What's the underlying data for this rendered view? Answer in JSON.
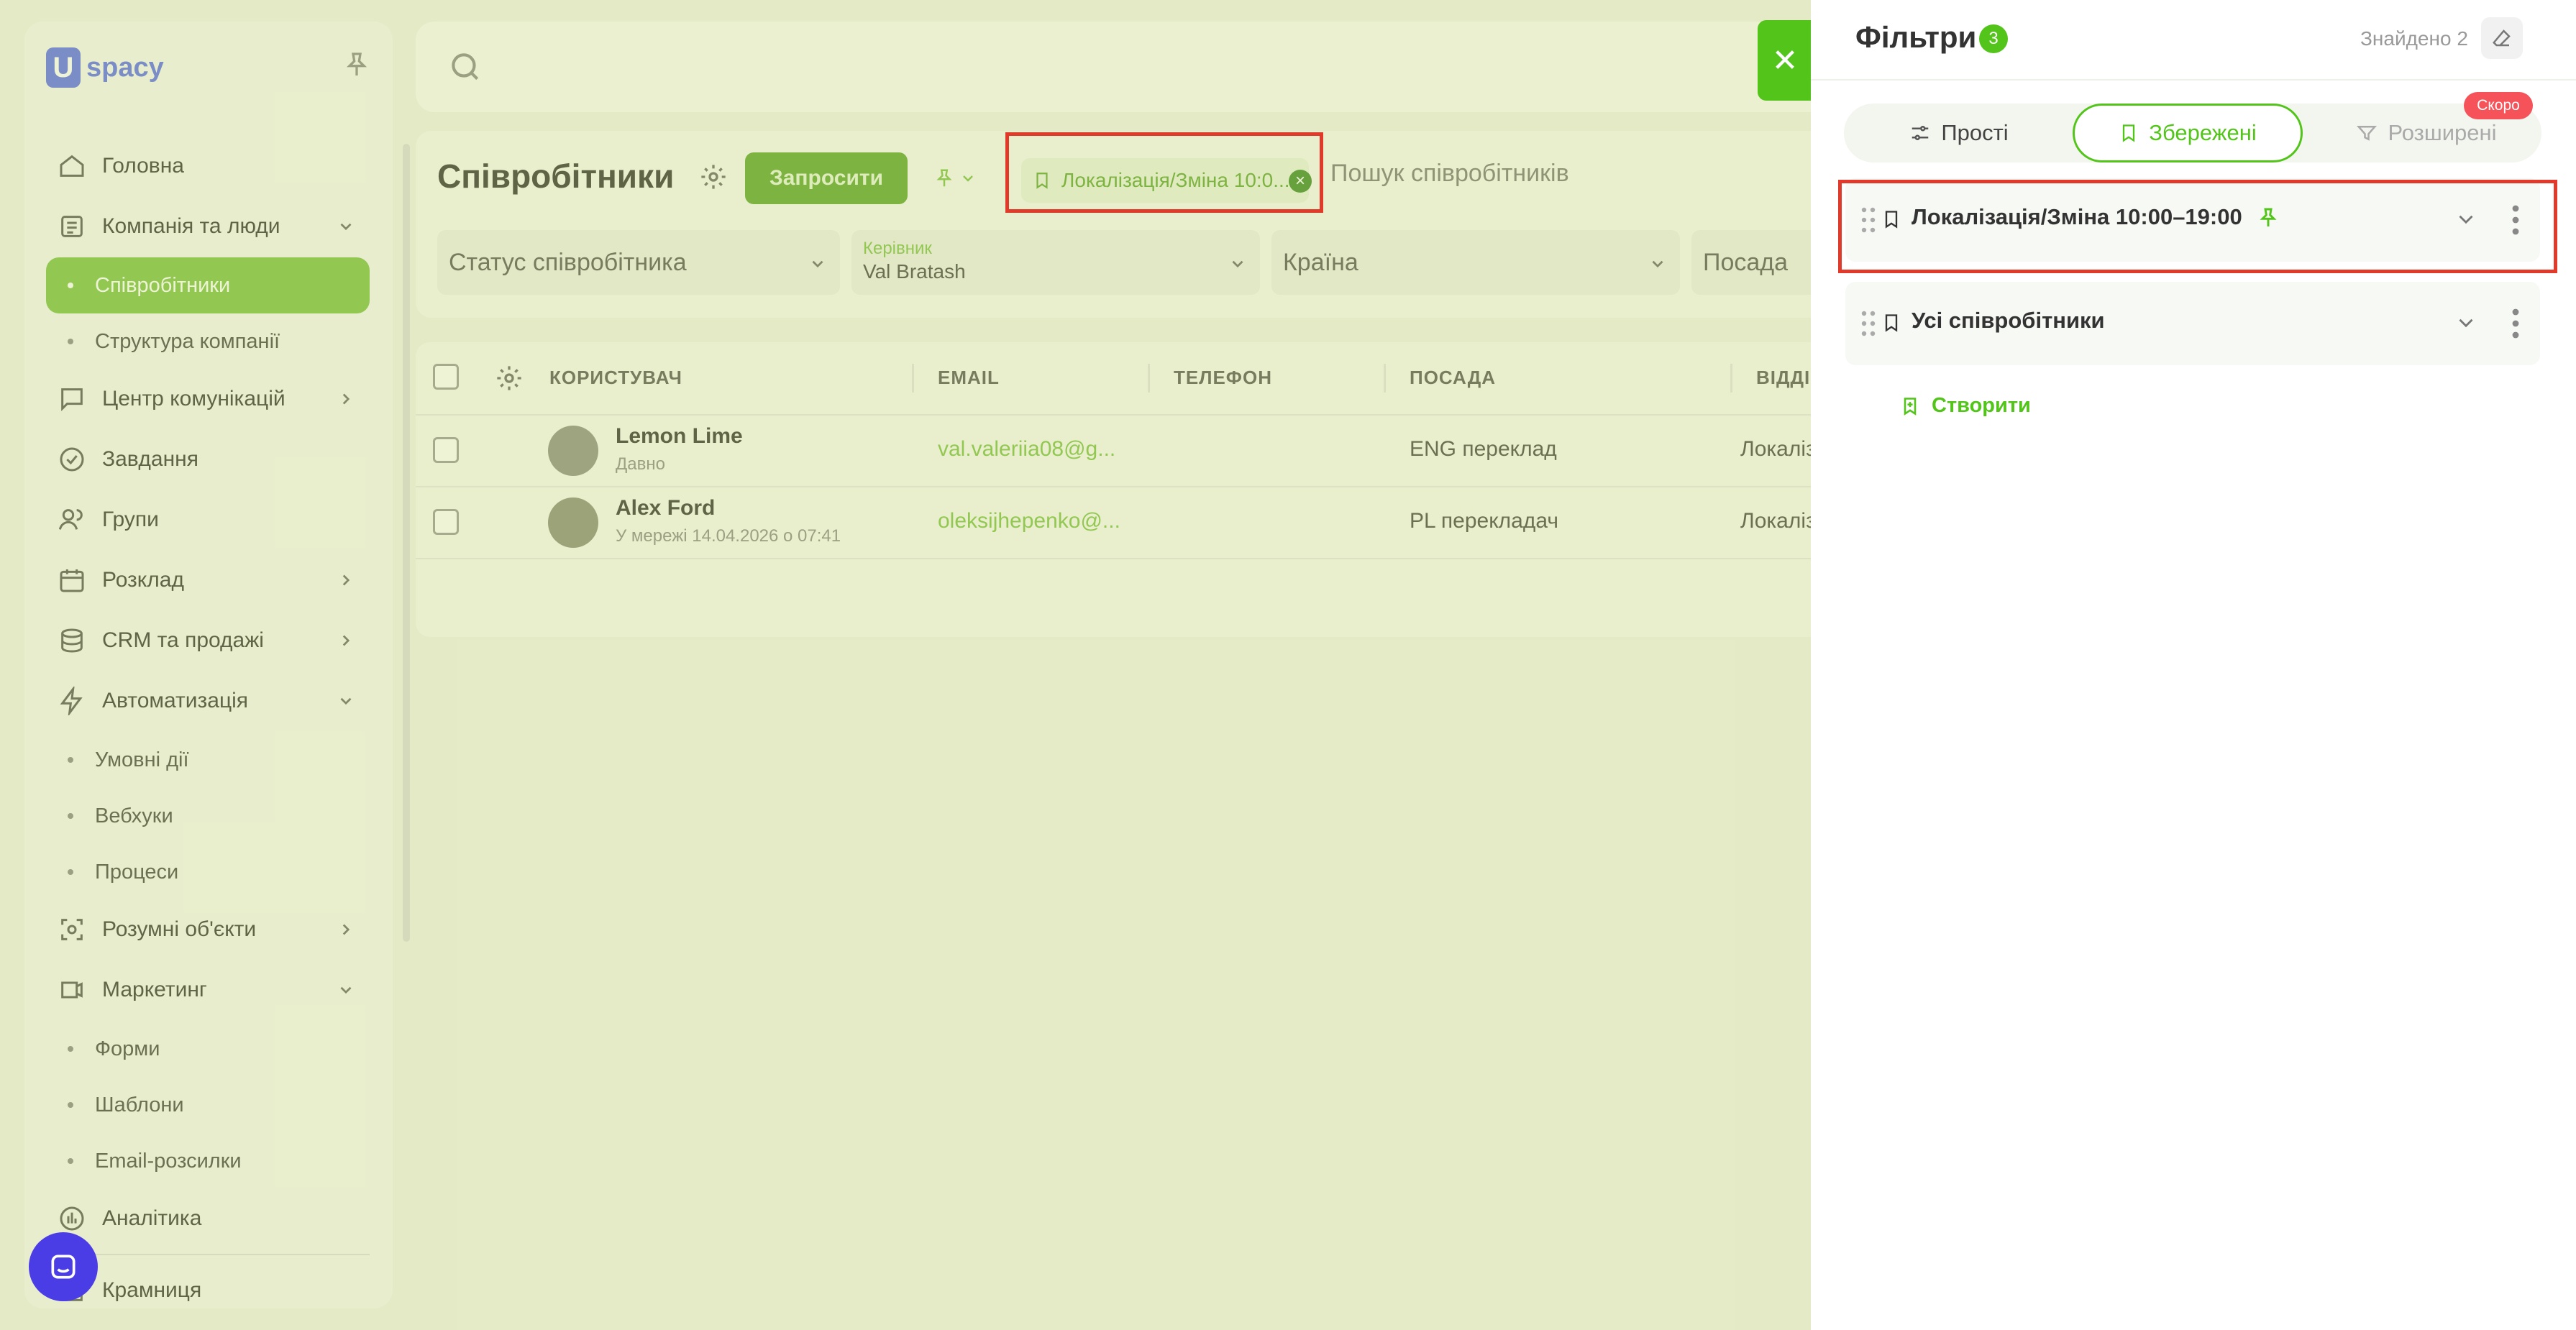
{
  "logo": {
    "mark": "U",
    "text": "spacy"
  },
  "sidebar": {
    "items": [
      {
        "label": "Головна",
        "icon": "home-icon",
        "type": "item"
      },
      {
        "label": "Компанія та люди",
        "icon": "company-icon",
        "type": "item",
        "chevron": "down"
      },
      {
        "label": "Співробітники",
        "type": "sub",
        "active": true
      },
      {
        "label": "Структура компанії",
        "type": "sub"
      },
      {
        "label": "Центр комунікацій",
        "icon": "communication-icon",
        "type": "item",
        "chevron": "right"
      },
      {
        "label": "Завдання",
        "icon": "tasks-icon",
        "type": "item"
      },
      {
        "label": "Групи",
        "icon": "groups-icon",
        "type": "item"
      },
      {
        "label": "Розклад",
        "icon": "calendar-icon",
        "type": "item",
        "chevron": "right"
      },
      {
        "label": "CRM та продажі",
        "icon": "crm-icon",
        "type": "item",
        "chevron": "right"
      },
      {
        "label": "Автоматизація",
        "icon": "automation-icon",
        "type": "item",
        "chevron": "down"
      },
      {
        "label": "Умовні дії",
        "type": "sub"
      },
      {
        "label": "Вебхуки",
        "type": "sub"
      },
      {
        "label": "Процеси",
        "type": "sub"
      },
      {
        "label": "Розумні об'єкти",
        "icon": "smart-objects-icon",
        "type": "item",
        "chevron": "right"
      },
      {
        "label": "Маркетинг",
        "icon": "marketing-icon",
        "type": "item",
        "chevron": "down"
      },
      {
        "label": "Форми",
        "type": "sub"
      },
      {
        "label": "Шаблони",
        "type": "sub"
      },
      {
        "label": "Email-розсилки",
        "type": "sub"
      },
      {
        "label": "Аналітика",
        "icon": "analytics-icon",
        "type": "item"
      },
      {
        "label": "Крамниця",
        "icon": "store-icon",
        "type": "item"
      }
    ]
  },
  "page": {
    "title": "Співробітники",
    "invite_label": "Запросити",
    "active_filter_chip": "Локалізація/Зміна 10:0...",
    "search_placeholder": "Пошук співробітників",
    "filters": {
      "status": "Статус співробітника",
      "manager_label": "Керівник",
      "manager_value": "Val Bratash",
      "country": "Країна",
      "position": "Посада"
    }
  },
  "table": {
    "columns": [
      "КОРИСТУВАЧ",
      "EMAIL",
      "ТЕЛЕФОН",
      "ПОСАДА",
      "ВІДДІ"
    ],
    "rows": [
      {
        "name": "Lemon Lime",
        "status": "Давно",
        "email": "val.valeriia08@g...",
        "phone": "",
        "position": "ENG переклад",
        "dept": "Локаліз"
      },
      {
        "name": "Alex Ford",
        "status": "У мережі 14.04.2026 о 07:41",
        "email": "oleksijhepenko@...",
        "phone": "",
        "position": "PL перекладач",
        "dept": "Локаліз"
      }
    ]
  },
  "panel": {
    "title": "Фільтри",
    "count": "3",
    "found": "Знайдено 2",
    "tabs": {
      "simple": "Прості",
      "saved": "Збережені",
      "advanced": "Розширені"
    },
    "soon_badge": "Скоро",
    "saved_filters": [
      {
        "name": "Локалізація/Зміна 10:00–19:00",
        "pinned": true
      },
      {
        "name": "Усі співробітники",
        "pinned": false
      }
    ],
    "create_label": "Створити"
  },
  "colors": {
    "accent": "#52c41a",
    "highlight": "#e23a2a",
    "soon": "#f5525a",
    "chat": "#4b3de6"
  }
}
